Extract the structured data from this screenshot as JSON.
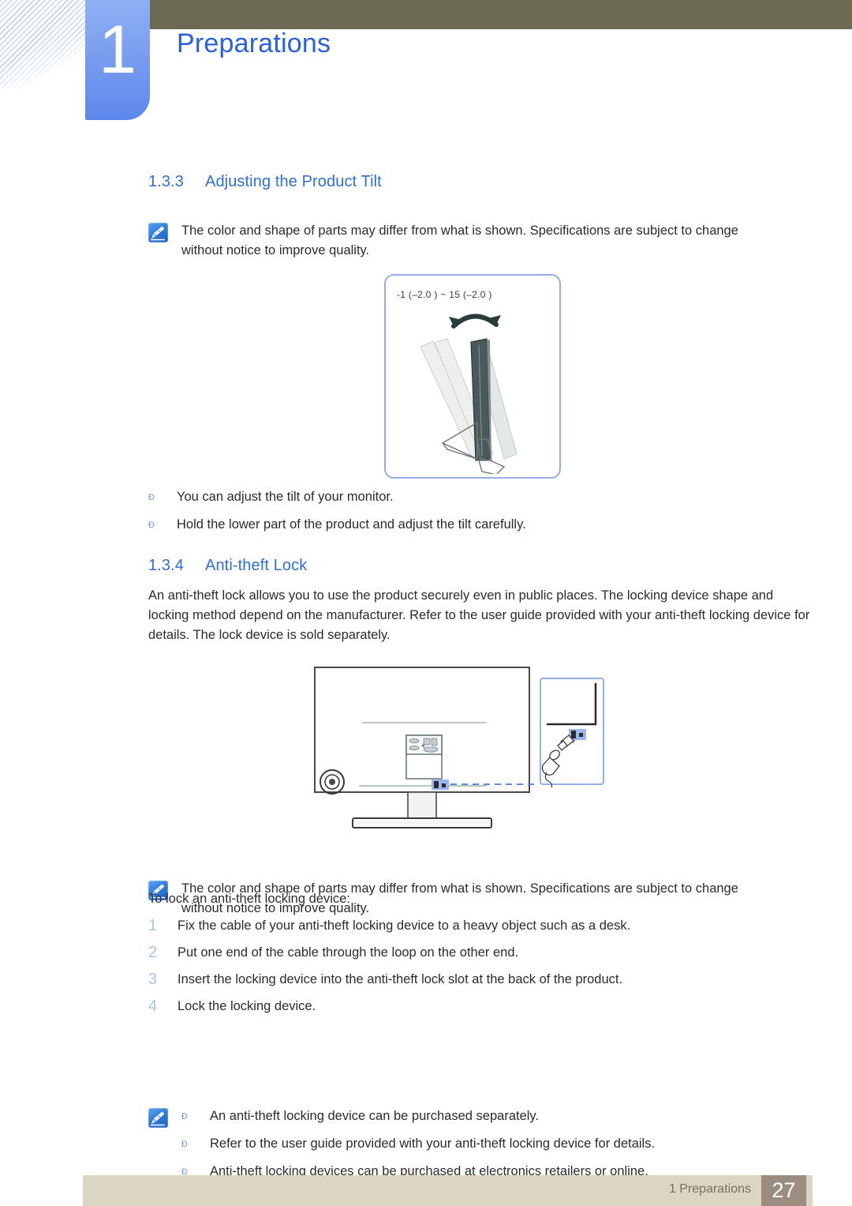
{
  "header": {
    "chapter_number": "1",
    "chapter_title": "Preparations"
  },
  "sections": [
    {
      "number": "1.3.3",
      "title": "Adjusting the Product Tilt"
    },
    {
      "number": "1.3.4",
      "title": "Anti-theft Lock"
    }
  ],
  "note_tilt": {
    "icon": "note-pen-icon",
    "text": "The color and shape of parts may differ from what is shown. Specifications are subject to change without notice to improve quality."
  },
  "tilt_figure": {
    "label": "-1  (–2.0 ) ~ 15  (–2.0 )",
    "alt": "Side view of monitor showing tilt range with rotation arrow"
  },
  "tilt_bullets": [
    {
      "mark": "Ð",
      "text": "You can adjust the tilt of your monitor."
    },
    {
      "mark": "Ð",
      "text": "Hold the lower part of the product and adjust the tilt carefully."
    }
  ],
  "antitheft_paragraph": "An anti-theft lock allows you to use the product securely even in public places. The locking device shape and locking method depend on the manufacturer. Refer to the user guide provided with your anti-theft locking device for details. The lock device is sold separately.",
  "lock_figure": {
    "alt": "Rear view of monitor with anti-theft lock slot and magnified callout showing lock device"
  },
  "note_lock": {
    "icon": "note-pen-icon",
    "text": "The color and shape of parts may differ from what is shown. Specifications are subject to change without notice to improve quality."
  },
  "steps_intro": "To lock an anti-theft locking device:",
  "steps": [
    {
      "num": "1",
      "text": "Fix the cable of your anti-theft locking device to a heavy object such as a desk."
    },
    {
      "num": "2",
      "text": "Put one end of the cable through the loop on the other end."
    },
    {
      "num": "3",
      "text": "Insert the locking device into the anti-theft lock slot at the back of the product."
    },
    {
      "num": "4",
      "text": "Lock the locking device."
    }
  ],
  "note_final": {
    "icon": "note-pen-icon",
    "bullets": [
      {
        "mark": "Ð",
        "text": "An anti-theft locking device can be purchased separately."
      },
      {
        "mark": "Ð",
        "text": "Refer to the user guide provided with your anti-theft locking device for details."
      },
      {
        "mark": "Ð",
        "text": "Anti-theft locking devices can be purchased at electronics retailers or online."
      }
    ]
  },
  "footer": {
    "label": "1 Preparations",
    "page": "27"
  },
  "colors": {
    "accent_blue": "#2e6fd8",
    "title_blue": "#2860e0",
    "olive": "#6d6a52",
    "footer_bg": "#dbd6c2",
    "footer_page_bg": "#9c8d81",
    "step_num": "#a9c2ea"
  }
}
